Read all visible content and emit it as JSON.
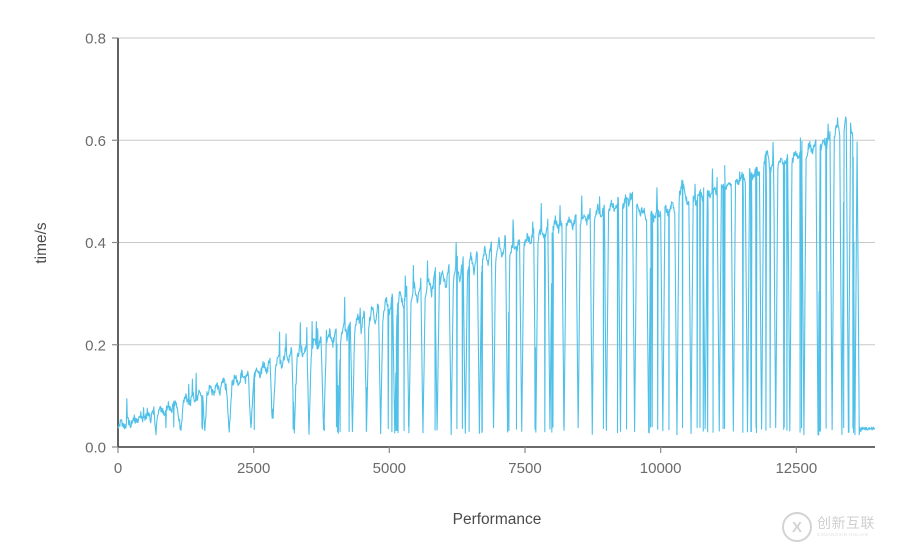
{
  "chart_data": {
    "type": "line",
    "title": "",
    "xlabel": "Performance",
    "ylabel": "time/s",
    "xlim": [
      0,
      13950
    ],
    "ylim": [
      0.0,
      0.8
    ],
    "grid": true,
    "grid_axis": "y",
    "legend": false,
    "line_color": "#4fc0e8",
    "line_width": 1.1,
    "xticks": [
      0,
      2500,
      5000,
      7500,
      10000,
      12500
    ],
    "xtick_labels": [
      "0",
      "2500",
      "5000",
      "7500",
      "10000",
      "12500"
    ],
    "yticks": [
      0.0,
      0.2,
      0.4,
      0.6,
      0.8
    ],
    "ytick_labels": [
      "0.0",
      "0.2",
      "0.4",
      "0.6",
      "0.8"
    ],
    "description": "Sawtooth timing trace: baseline time rises roughly linearly from 0.04 s to about 0.645 s as Performance increases to ~13400, punctuated by frequent sharp downward spikes to ~0.03 s; after ~13700 the trace collapses to a flat tail near 0.035 s.",
    "series": [
      {
        "name": "time/s",
        "color": "#4fc0e8",
        "ramp_baseline_start": 0.042,
        "ramp_baseline_end": 0.62,
        "spike_floor": 0.028,
        "tail_start_x": 13700,
        "tail_value": 0.036,
        "max_value": 0.647,
        "min_value": 0.027,
        "points": [
          [
            0,
            0.042
          ],
          [
            60,
            0.047
          ],
          [
            120,
            0.039
          ],
          [
            180,
            0.052
          ],
          [
            240,
            0.044
          ],
          [
            300,
            0.056
          ],
          [
            360,
            0.048
          ],
          [
            420,
            0.062
          ],
          [
            480,
            0.051
          ],
          [
            540,
            0.068
          ],
          [
            600,
            0.055
          ],
          [
            660,
            0.072
          ],
          [
            700,
            0.031
          ],
          [
            740,
            0.066
          ],
          [
            800,
            0.078
          ],
          [
            860,
            0.061
          ],
          [
            920,
            0.084
          ],
          [
            980,
            0.07
          ],
          [
            1040,
            0.09
          ],
          [
            1100,
            0.075
          ],
          [
            1160,
            0.029
          ],
          [
            1200,
            0.086
          ],
          [
            1260,
            0.098
          ],
          [
            1320,
            0.082
          ],
          [
            1380,
            0.104
          ],
          [
            1440,
            0.089
          ],
          [
            1500,
            0.11
          ],
          [
            1560,
            0.095
          ],
          [
            1600,
            0.03
          ],
          [
            1640,
            0.101
          ],
          [
            1700,
            0.118
          ],
          [
            1760,
            0.103
          ],
          [
            1820,
            0.124
          ],
          [
            1880,
            0.109
          ],
          [
            1940,
            0.131
          ],
          [
            2000,
            0.114
          ],
          [
            2050,
            0.028
          ],
          [
            2100,
            0.122
          ],
          [
            2160,
            0.138
          ],
          [
            2220,
            0.12
          ],
          [
            2280,
            0.144
          ],
          [
            2340,
            0.128
          ],
          [
            2400,
            0.15
          ],
          [
            2450,
            0.031
          ],
          [
            2500,
            0.134
          ],
          [
            2560,
            0.158
          ],
          [
            2620,
            0.14
          ],
          [
            2680,
            0.165
          ],
          [
            2740,
            0.146
          ],
          [
            2800,
            0.172
          ],
          [
            2850,
            0.029
          ],
          [
            2900,
            0.152
          ],
          [
            2960,
            0.179
          ],
          [
            3020,
            0.158
          ],
          [
            3080,
            0.186
          ],
          [
            3140,
            0.164
          ],
          [
            3200,
            0.192
          ],
          [
            3250,
            0.03
          ],
          [
            3300,
            0.17
          ],
          [
            3360,
            0.199
          ],
          [
            3420,
            0.176
          ],
          [
            3480,
            0.206
          ],
          [
            3520,
            0.028
          ],
          [
            3560,
            0.182
          ],
          [
            3620,
            0.213
          ],
          [
            3680,
            0.188
          ],
          [
            3740,
            0.22
          ],
          [
            3790,
            0.031
          ],
          [
            3840,
            0.195
          ],
          [
            3900,
            0.228
          ],
          [
            3960,
            0.201
          ],
          [
            4020,
            0.236
          ],
          [
            4060,
            0.029
          ],
          [
            4100,
            0.208
          ],
          [
            4160,
            0.244
          ],
          [
            4220,
            0.215
          ],
          [
            4280,
            0.252
          ],
          [
            4320,
            0.03
          ],
          [
            4360,
            0.222
          ],
          [
            4420,
            0.26
          ],
          [
            4480,
            0.229
          ],
          [
            4540,
            0.268
          ],
          [
            4580,
            0.028
          ],
          [
            4620,
            0.236
          ],
          [
            4680,
            0.276
          ],
          [
            4740,
            0.243
          ],
          [
            4800,
            0.284
          ],
          [
            4840,
            0.031
          ],
          [
            4880,
            0.25
          ],
          [
            4940,
            0.292
          ],
          [
            5000,
            0.258
          ],
          [
            5060,
            0.3
          ],
          [
            5100,
            0.029
          ],
          [
            5140,
            0.265
          ],
          [
            5200,
            0.306
          ],
          [
            5260,
            0.272
          ],
          [
            5320,
            0.312
          ],
          [
            5360,
            0.03
          ],
          [
            5400,
            0.279
          ],
          [
            5460,
            0.318
          ],
          [
            5520,
            0.286
          ],
          [
            5580,
            0.324
          ],
          [
            5620,
            0.028
          ],
          [
            5660,
            0.293
          ],
          [
            5720,
            0.33
          ],
          [
            5780,
            0.3
          ],
          [
            5840,
            0.337
          ],
          [
            5880,
            0.031
          ],
          [
            5920,
            0.307
          ],
          [
            5980,
            0.344
          ],
          [
            6040,
            0.314
          ],
          [
            6100,
            0.351
          ],
          [
            6140,
            0.029
          ],
          [
            6180,
            0.321
          ],
          [
            6240,
            0.358
          ],
          [
            6300,
            0.328
          ],
          [
            6360,
            0.366
          ],
          [
            6400,
            0.03
          ],
          [
            6440,
            0.335
          ],
          [
            6500,
            0.374
          ],
          [
            6560,
            0.342
          ],
          [
            6620,
            0.382
          ],
          [
            6660,
            0.028
          ],
          [
            6700,
            0.349
          ],
          [
            6760,
            0.39
          ],
          [
            6820,
            0.356
          ],
          [
            6880,
            0.398
          ],
          [
            6920,
            0.031
          ],
          [
            6960,
            0.363
          ],
          [
            7020,
            0.406
          ],
          [
            7080,
            0.37
          ],
          [
            7140,
            0.414
          ],
          [
            7180,
            0.029
          ],
          [
            7220,
            0.377
          ],
          [
            7280,
            0.398
          ],
          [
            7340,
            0.384
          ],
          [
            7400,
            0.406
          ],
          [
            7440,
            0.03
          ],
          [
            7480,
            0.391
          ],
          [
            7540,
            0.414
          ],
          [
            7600,
            0.398
          ],
          [
            7660,
            0.422
          ],
          [
            7700,
            0.028
          ],
          [
            7740,
            0.405
          ],
          [
            7800,
            0.43
          ],
          [
            7860,
            0.412
          ],
          [
            7920,
            0.438
          ],
          [
            7960,
            0.031
          ],
          [
            8000,
            0.419
          ],
          [
            8060,
            0.446
          ],
          [
            8120,
            0.426
          ],
          [
            8180,
            0.44
          ],
          [
            8220,
            0.029
          ],
          [
            8260,
            0.433
          ],
          [
            8320,
            0.448
          ],
          [
            8380,
            0.428
          ],
          [
            8440,
            0.452
          ],
          [
            8480,
            0.03
          ],
          [
            8520,
            0.436
          ],
          [
            8580,
            0.456
          ],
          [
            8640,
            0.44
          ],
          [
            8700,
            0.462
          ],
          [
            8740,
            0.028
          ],
          [
            8780,
            0.445
          ],
          [
            8840,
            0.468
          ],
          [
            8900,
            0.45
          ],
          [
            8960,
            0.474
          ],
          [
            9000,
            0.031
          ],
          [
            9040,
            0.455
          ],
          [
            9100,
            0.48
          ],
          [
            9160,
            0.46
          ],
          [
            9220,
            0.486
          ],
          [
            9260,
            0.029
          ],
          [
            9300,
            0.466
          ],
          [
            9360,
            0.492
          ],
          [
            9420,
            0.472
          ],
          [
            9480,
            0.498
          ],
          [
            9520,
            0.03
          ],
          [
            9560,
            0.478
          ],
          [
            9620,
            0.452
          ],
          [
            9680,
            0.47
          ],
          [
            9740,
            0.44
          ],
          [
            9780,
            0.028
          ],
          [
            9820,
            0.456
          ],
          [
            9880,
            0.446
          ],
          [
            9940,
            0.462
          ],
          [
            10000,
            0.452
          ],
          [
            10040,
            0.031
          ],
          [
            10080,
            0.468
          ],
          [
            10140,
            0.458
          ],
          [
            10200,
            0.474
          ],
          [
            10260,
            0.464
          ],
          [
            10300,
            0.029
          ],
          [
            10340,
            0.48
          ],
          [
            10400,
            0.52
          ],
          [
            10460,
            0.486
          ],
          [
            10520,
            0.472
          ],
          [
            10560,
            0.03
          ],
          [
            10600,
            0.49
          ],
          [
            10660,
            0.478
          ],
          [
            10720,
            0.496
          ],
          [
            10780,
            0.484
          ],
          [
            10820,
            0.028
          ],
          [
            10860,
            0.502
          ],
          [
            10920,
            0.49
          ],
          [
            10980,
            0.508
          ],
          [
            11040,
            0.496
          ],
          [
            11080,
            0.031
          ],
          [
            11120,
            0.514
          ],
          [
            11180,
            0.502
          ],
          [
            11240,
            0.52
          ],
          [
            11300,
            0.508
          ],
          [
            11340,
            0.029
          ],
          [
            11380,
            0.526
          ],
          [
            11440,
            0.514
          ],
          [
            11500,
            0.532
          ],
          [
            11560,
            0.52
          ],
          [
            11600,
            0.03
          ],
          [
            11640,
            0.538
          ],
          [
            11700,
            0.526
          ],
          [
            11760,
            0.544
          ],
          [
            11820,
            0.532
          ],
          [
            11860,
            0.028
          ],
          [
            11900,
            0.55
          ],
          [
            11960,
            0.58
          ],
          [
            12020,
            0.54
          ],
          [
            12080,
            0.556
          ],
          [
            12120,
            0.031
          ],
          [
            12160,
            0.545
          ],
          [
            12220,
            0.562
          ],
          [
            12280,
            0.551
          ],
          [
            12340,
            0.568
          ],
          [
            12380,
            0.029
          ],
          [
            12420,
            0.557
          ],
          [
            12480,
            0.574
          ],
          [
            12540,
            0.563
          ],
          [
            12600,
            0.58
          ],
          [
            12640,
            0.03
          ],
          [
            12680,
            0.569
          ],
          [
            12740,
            0.592
          ],
          [
            12800,
            0.575
          ],
          [
            12860,
            0.598
          ],
          [
            12900,
            0.028
          ],
          [
            12940,
            0.581
          ],
          [
            13000,
            0.604
          ],
          [
            13060,
            0.588
          ],
          [
            13120,
            0.61
          ],
          [
            13160,
            0.031
          ],
          [
            13200,
            0.6
          ],
          [
            13260,
            0.64
          ],
          [
            13300,
            0.614
          ],
          [
            13340,
            0.028
          ],
          [
            13380,
            0.622
          ],
          [
            13420,
            0.647
          ],
          [
            13460,
            0.03
          ],
          [
            13500,
            0.63
          ],
          [
            13540,
            0.61
          ],
          [
            13580,
            0.029
          ],
          [
            13620,
            0.6
          ],
          [
            13660,
            0.031
          ],
          [
            13700,
            0.038
          ],
          [
            13760,
            0.034
          ],
          [
            13820,
            0.037
          ],
          [
            13880,
            0.035
          ],
          [
            13940,
            0.036
          ]
        ]
      }
    ]
  },
  "watermark": {
    "logo_glyph": "X",
    "text_cn": "创新互联",
    "text_sub": "CHUANGXIN HULIAN"
  }
}
